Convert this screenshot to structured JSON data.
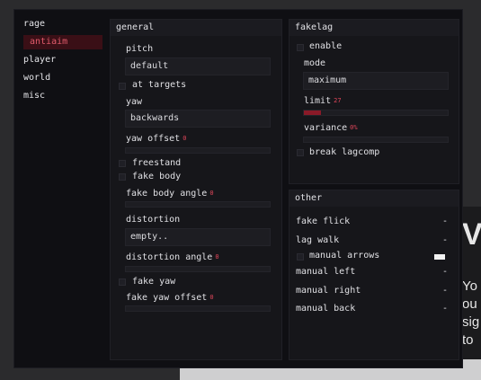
{
  "sidebar": {
    "items": [
      {
        "label": "rage"
      },
      {
        "label": "antiaim",
        "active": true
      },
      {
        "label": "player"
      },
      {
        "label": "world"
      },
      {
        "label": "misc"
      }
    ]
  },
  "general": {
    "title": "general",
    "pitch_label": "pitch",
    "pitch_value": "default",
    "at_targets_label": "at targets",
    "yaw_label": "yaw",
    "yaw_value": "backwards",
    "yaw_offset_label": "yaw offset",
    "yaw_offset_value": "0",
    "freestand_label": "freestand",
    "fake_body_label": "fake body",
    "fake_body_angle_label": "fake body angle",
    "fake_body_angle_value": "0",
    "distortion_label": "distortion",
    "distortion_value": "empty..",
    "distortion_angle_label": "distortion angle",
    "distortion_angle_value": "0",
    "fake_yaw_label": "fake yaw",
    "fake_yaw_offset_label": "fake yaw offset",
    "fake_yaw_offset_value": "0"
  },
  "fakelag": {
    "title": "fakelag",
    "enable_label": "enable",
    "mode_label": "mode",
    "mode_value": "maximum",
    "limit_label": "limit",
    "limit_value": "27",
    "limit_fraction": 0.12,
    "variance_label": "variance",
    "variance_value": "0%",
    "break_lagcomp_label": "break lagcomp"
  },
  "other": {
    "title": "other",
    "fake_flick_label": "fake flick",
    "fake_flick_key": "-",
    "lag_walk_label": "lag walk",
    "lag_walk_key": "-",
    "manual_arrows_label": "manual arrows",
    "manual_left_label": "manual left",
    "manual_left_key": "-",
    "manual_right_label": "manual right",
    "manual_right_key": "-",
    "manual_back_label": "manual back",
    "manual_back_key": "-"
  },
  "background": {
    "big_text": "Va",
    "line1": "Yo",
    "line2": "ou",
    "line3": "sig",
    "line4": "to"
  },
  "colors": {
    "accent": "#e0465a",
    "active_bg": "#3a0f16",
    "menu_bg": "#0f0f13"
  }
}
